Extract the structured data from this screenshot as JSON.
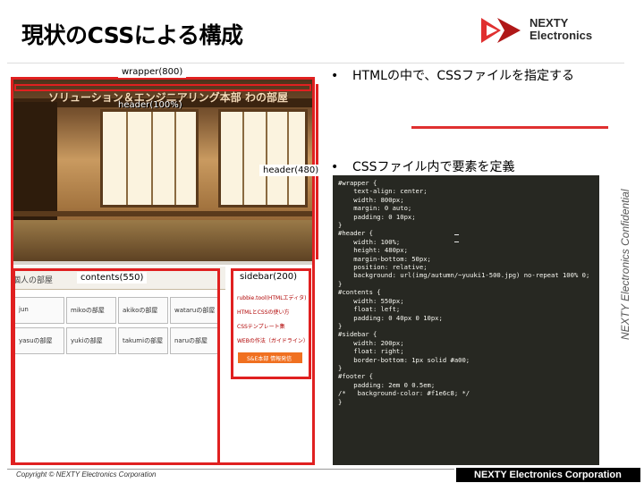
{
  "slide": {
    "title": "現状のCSSによる構成",
    "brand": {
      "line1": "NEXTY",
      "line2": "Electronics",
      "accent": "#e03030"
    },
    "confidential": "NEXTY Electronics Confidential",
    "bullets": [
      {
        "marker": "•",
        "text": "HTMLの中で、CSSファイルを指定する"
      },
      {
        "marker": "•",
        "text": "CSSファイル内で要素を定義"
      }
    ],
    "footer": {
      "copyright": "Copyright © NEXTY Electronics Corporation",
      "company": "NEXTY Electronics Corporation"
    }
  },
  "mockup": {
    "banner": "ソリューション＆エンジニアリング本部 わの部屋",
    "room_label": "個人の部屋",
    "grid": [
      "jun",
      "mikoの部屋",
      "akikoの部屋",
      "wataruの部屋",
      "yasuの部屋",
      "yukiの部屋",
      "takumiの部屋",
      "naruの部屋"
    ],
    "sidebar_links": [
      "rubbie.tool(HTMLエディタ)",
      "HTMLとCSSの使い方",
      "CSSテンプレート集",
      "WEBの作法（ガイドライン）"
    ],
    "sidebar_button": "S&E本部 情報発信",
    "labels": {
      "wrapper": "wrapper(800)",
      "header_width": "header(100%)",
      "header_height": "header(480)",
      "contents": "contents(550)",
      "sidebar": "sidebar(200)"
    },
    "outline_color": "#e02020"
  },
  "code": {
    "lines": [
      "#wrapper {",
      "    text-align: center;",
      "    width: 800px;",
      "    margin: 0 auto;",
      "    padding: 0 10px;",
      "}",
      "",
      "#header {",
      "    width: 100%;",
      "    height: 480px;",
      "    margin-bottom: 50px;",
      "    position: relative;",
      "    background: url(img/autumn/~yuuki1-500.jpg) no-repeat 100% 0;",
      "}",
      "",
      "#contents {",
      "    width: 550px;",
      "    float: left;",
      "    padding: 0 40px 0 10px;",
      "}",
      "",
      "#sidebar {",
      "    width: 200px;",
      "    float: right;",
      "    border-bottom: 1px solid #a00;",
      "}",
      "",
      "#footer {",
      "    padding: 2em 0 0.5em;",
      "/*   background-color: #f1e6c8; */",
      "}"
    ]
  }
}
